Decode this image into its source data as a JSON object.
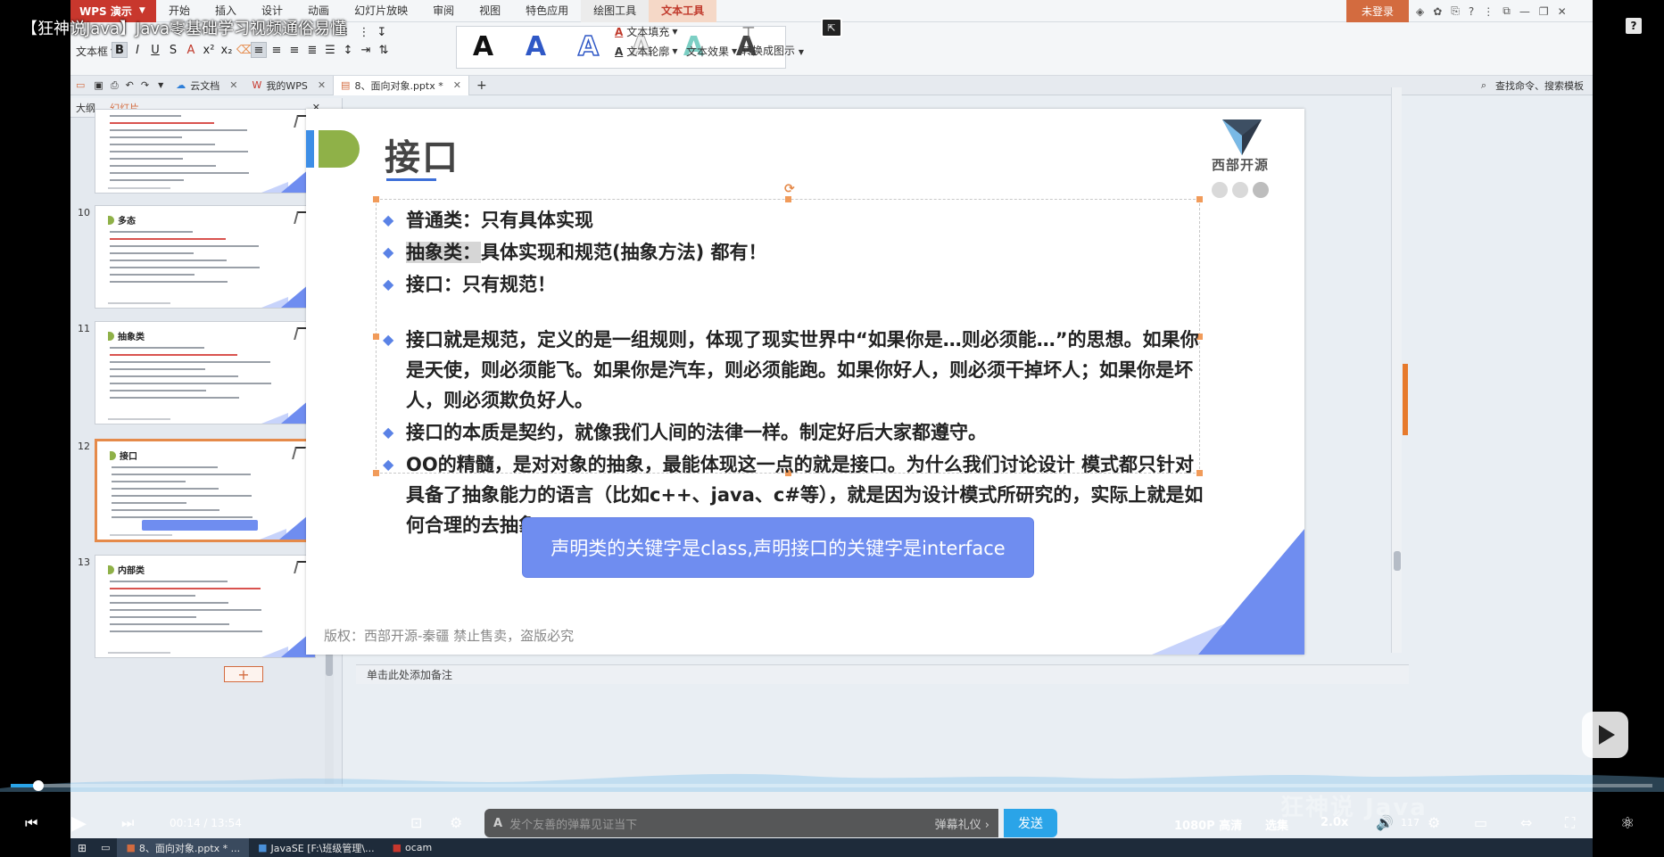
{
  "video": {
    "title": "【狂神说Java】Java零基础学习视频通俗易懂",
    "time_current": "00:14",
    "time_total": "13:54",
    "danmaku_placeholder": "发个友善的弹幕见证当下",
    "danmaku_etiquette": "弹幕礼仪 ›",
    "send_label": "发送",
    "quality": "1080P 高清",
    "episodes": "选集",
    "speed": "2.0x",
    "volume": "117",
    "watermark": "狂神说 Java",
    "progress_fraction": 0.017
  },
  "app": {
    "logo": "WPS 演示",
    "menu": [
      "开始",
      "插入",
      "设计",
      "动画",
      "幻灯片放映",
      "审阅",
      "视图",
      "特色应用",
      "绘图工具",
      "文本工具"
    ],
    "active_menu_index": 9,
    "tool_menu_index": 8,
    "login": "未登录"
  },
  "ribbon": {
    "text_box": "文本框",
    "text_fill": "文本填充",
    "text_outline": "文本轮廓",
    "text_effect": "文本效果",
    "convert_smartart": "转换成图示",
    "wordart_letter": "A"
  },
  "tabs": [
    {
      "label": "云文档",
      "active": false
    },
    {
      "label": "我的WPS",
      "active": false
    },
    {
      "label": "8、面向对象.pptx *",
      "active": true
    }
  ],
  "tab_right": {
    "search": "查找命令、搜索模板"
  },
  "pane": {
    "outline_label": "大纲",
    "slides_label": "幻灯片",
    "thumbs": [
      {
        "num": "",
        "title": ""
      },
      {
        "num": "10",
        "title": "多态"
      },
      {
        "num": "11",
        "title": "抽象类"
      },
      {
        "num": "12",
        "title": "接口"
      },
      {
        "num": "13",
        "title": "内部类"
      }
    ]
  },
  "slide": {
    "title": "接口",
    "brand": "西部开源",
    "bullets": [
      {
        "text": "普通类：只有具体实现"
      },
      {
        "text_hl": "抽象类：",
        "text": "具体实现和规范(抽象方法) 都有！"
      },
      {
        "text": "接口：只有规范！"
      }
    ],
    "paragraphs": [
      "接口就是规范，定义的是一组规则，体现了现实世界中“如果你是…则必须能…”的思想。如果你是天使，则必须能飞。如果你是汽车，则必须能跑。如果你好人，则必须干掉坏人；如果你是坏人，则必须欺负好人。",
      "接口的本质是契约，就像我们人间的法律一样。制定好后大家都遵守。",
      "OO的精髓，是对对象的抽象，最能体现这一点的就是接口。为什么我们讨论设计 模式都只针对具备了抽象能力的语言（比如c++、java、c#等），就是因为设计模式所研究的，实际上就是如何合理的去抽象。"
    ],
    "callout": "声明类的关键字是class,声明接口的关键字是interface",
    "copyright": "版权：西部开源-秦疆      禁止售卖，盗版必究"
  },
  "notes_placeholder": "单击此处添加备注",
  "taskbar": [
    {
      "label": "8、面向对象.pptx * ...",
      "active": true
    },
    {
      "label": "JavaSE [F:\\班级管理\\...",
      "active": false
    },
    {
      "label": "ocam",
      "active": false
    }
  ],
  "colors": {
    "accent_blue": "#6f8df0",
    "wps_red": "#c8372d",
    "progress": "#2aa4e8"
  }
}
